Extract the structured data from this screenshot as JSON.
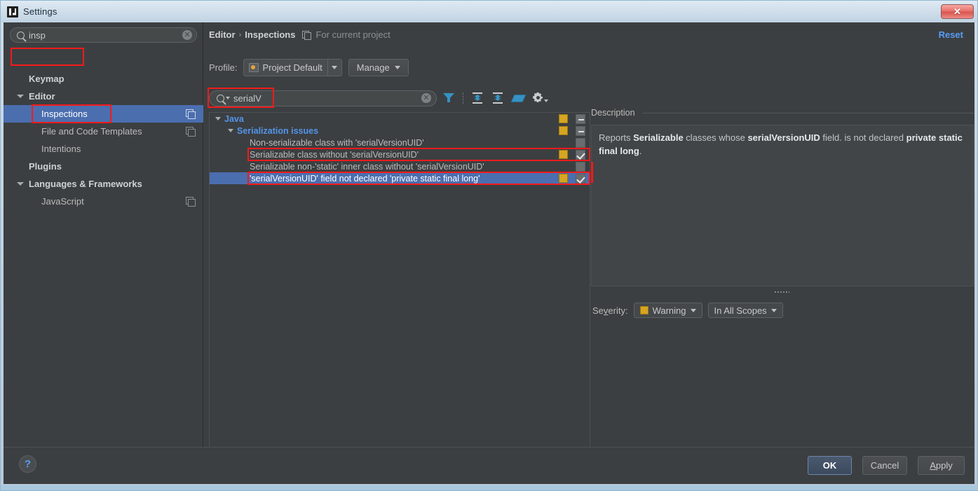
{
  "window": {
    "title": "Settings",
    "app_icon": "intellij-idea-icon",
    "close_label": "✕"
  },
  "sidebar": {
    "search": {
      "value": "insp",
      "icon": "search-icon",
      "clear_icon": "clear-icon"
    },
    "items": [
      {
        "label": "Keymap",
        "level": 0,
        "bold": true,
        "expandable": false,
        "selected": false,
        "copy_icon": false
      },
      {
        "label": "Editor",
        "level": 0,
        "bold": true,
        "expandable": true,
        "selected": false,
        "copy_icon": false
      },
      {
        "label": "Inspections",
        "level": 1,
        "bold": false,
        "expandable": false,
        "selected": true,
        "copy_icon": true
      },
      {
        "label": "File and Code Templates",
        "level": 1,
        "bold": false,
        "expandable": false,
        "selected": false,
        "copy_icon": true
      },
      {
        "label": "Intentions",
        "level": 1,
        "bold": false,
        "expandable": false,
        "selected": false,
        "copy_icon": false
      },
      {
        "label": "Plugins",
        "level": 0,
        "bold": true,
        "expandable": false,
        "selected": false,
        "copy_icon": false
      },
      {
        "label": "Languages & Frameworks",
        "level": 0,
        "bold": true,
        "expandable": true,
        "selected": false,
        "copy_icon": false
      },
      {
        "label": "JavaScript",
        "level": 1,
        "bold": false,
        "expandable": false,
        "selected": false,
        "copy_icon": true
      }
    ]
  },
  "header": {
    "breadcrumb_root": "Editor",
    "breadcrumb_sep": "›",
    "breadcrumb_current": "Inspections",
    "scope_icon": "copy-scope-icon",
    "scope_text": "For current project",
    "reset_label": "Reset"
  },
  "profile": {
    "label": "Profile:",
    "selected": "Project Default",
    "icon": "profile-icon",
    "manage_label": "Manage"
  },
  "inspection_search": {
    "value": "serialV",
    "icon": "search-icon",
    "clear_icon": "clear-icon",
    "toolbar": [
      {
        "name": "filter-icon",
        "title": "Filter inspections"
      },
      {
        "name": "expand-all-icon",
        "title": "Expand all"
      },
      {
        "name": "collapse-all-icon",
        "title": "Collapse all"
      },
      {
        "name": "reset-to-empty-icon",
        "title": "Reset to empty"
      },
      {
        "name": "gear-icon",
        "title": "Options"
      }
    ]
  },
  "tree": {
    "rows": [
      {
        "label": "Java",
        "indent": 0,
        "type": "category",
        "expandable": true,
        "severity": true,
        "checkbox": "minus",
        "selected": false,
        "highlighted": false
      },
      {
        "label": "Serialization issues",
        "indent": 1,
        "type": "category",
        "expandable": true,
        "severity": true,
        "checkbox": "minus",
        "selected": false,
        "highlighted": false
      },
      {
        "label": "Non-serializable class with 'serialVersionUID'",
        "indent": 2,
        "type": "item",
        "expandable": false,
        "severity": false,
        "checkbox": "empty",
        "selected": false,
        "highlighted": false
      },
      {
        "label": "Serializable class without 'serialVersionUID'",
        "indent": 2,
        "type": "item",
        "expandable": false,
        "severity": true,
        "checkbox": "checked",
        "selected": false,
        "highlighted": true
      },
      {
        "label": "Serializable non-'static' inner class without 'serialVersionUID'",
        "indent": 2,
        "type": "item",
        "expandable": false,
        "severity": false,
        "checkbox": "empty",
        "selected": false,
        "highlighted": false
      },
      {
        "label": "'serialVersionUID' field not declared 'private static final long'",
        "indent": 2,
        "type": "item",
        "expandable": false,
        "severity": true,
        "checkbox": "checked",
        "selected": true,
        "highlighted": true
      }
    ]
  },
  "description": {
    "title": "Description",
    "text_parts": [
      {
        "t": "Reports ",
        "b": false
      },
      {
        "t": "Serializable",
        "b": true
      },
      {
        "t": " classes whose ",
        "b": false
      },
      {
        "t": "serialVersionUID",
        "b": true
      },
      {
        "t": " field. is not declared ",
        "b": false
      },
      {
        "t": "private static final long",
        "b": true
      },
      {
        "t": ".",
        "b": false
      }
    ]
  },
  "severity": {
    "label": "Severity:",
    "value": "Warning",
    "color": "#d6a521",
    "scope": "In All Scopes"
  },
  "footer": {
    "help_label": "?",
    "ok_label": "OK",
    "cancel_label": "Cancel",
    "apply_label": "Apply"
  }
}
